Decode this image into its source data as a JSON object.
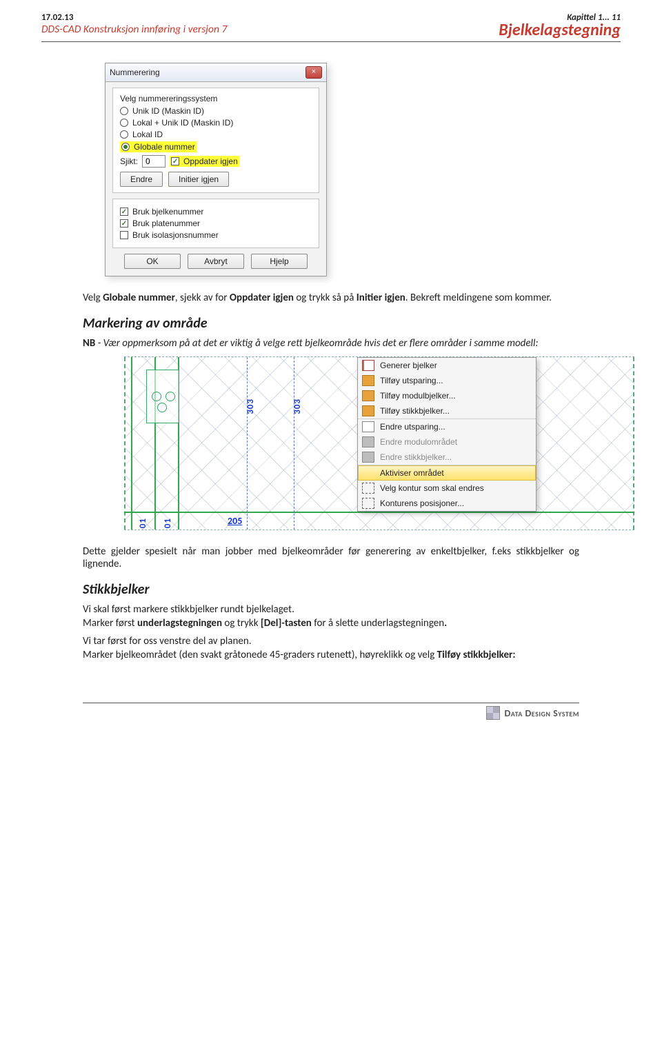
{
  "header": {
    "date": "17.02.13",
    "chapter": "Kapittel 1... 11",
    "sub": "DDS-CAD Konstruksjon  innføring i versjon 7",
    "title": "Bjelkelagstegning"
  },
  "dialog": {
    "title": "Nummerering",
    "close": "×",
    "prompt": "Velg nummereringssystem",
    "radios": {
      "r1": "Unik ID (Maskin ID)",
      "r2": "Lokal + Unik ID (Maskin ID)",
      "r3": "Lokal ID",
      "r4": "Globale nummer"
    },
    "sjikt_label": "Sjikt:",
    "sjikt_value": "0",
    "oppd_chk": "Oppdater igjen",
    "btn_endre": "Endre",
    "btn_initier": "Initier igjen",
    "chk_bjelke": "Bruk bjelkenummer",
    "chk_plate": "Bruk platenummer",
    "chk_isol": "Bruk isolasjonsnummer",
    "btn_ok": "OK",
    "btn_avbryt": "Avbryt",
    "btn_hjelp": "Hjelp"
  },
  "body": {
    "p1a": "Velg ",
    "p1b": "Globale nummer",
    "p1c": ", sjekk av for ",
    "p1d": "Oppdater igjen",
    "p1e": " og trykk så på ",
    "p1f": "Initier igjen",
    "p1g": ". Bekreft meldingene som kommer.",
    "h2": "Markering av område",
    "p2a": "NB",
    "p2b": " - Vær oppmerksom på at det er viktig å velge rett bjelkeområde hvis det er flere områder i samme modell:",
    "p3": "Dette gjelder spesielt når man jobber med bjelkeområder før generering av enkeltbjelker, f.eks stikkbjelker og lignende.",
    "h3": "Stikkbjelker",
    "p4": "Vi skal først markere stikkbjelker rundt bjelkelaget.",
    "p5a": "Marker først ",
    "p5b": "underlagstegningen",
    "p5c": " og trykk ",
    "p5d": "[Del]-tasten",
    "p5e": " for å slette underlagstegningen",
    "p5f": ".",
    "p6": "Vi tar først for oss venstre del av planen.",
    "p7a": "Marker bjelkeområdet (den svakt gråtonede 45-graders rutenett), høyreklikk og velg ",
    "p7b": "Tilføy stikkbjelker:"
  },
  "cad": {
    "l303a": "303",
    "l303b": "303",
    "l01a": "01",
    "l01b": "01",
    "dim205": "205"
  },
  "ctx": {
    "m1": "Generer bjelker",
    "m2": "Tilføy utsparing...",
    "m3": "Tilføy modulbjelker...",
    "m4": "Tilføy stikkbjelker...",
    "m5": "Endre utsparing...",
    "m6": "Endre modulområdet",
    "m7": "Endre stikkbjelker...",
    "m8": "Aktiviser området",
    "m9": "Velg kontur som skal endres",
    "m10": "Konturens posisjoner..."
  },
  "footer": {
    "brand_a": "Data",
    "brand_b": "Design",
    "brand_c": "System"
  }
}
